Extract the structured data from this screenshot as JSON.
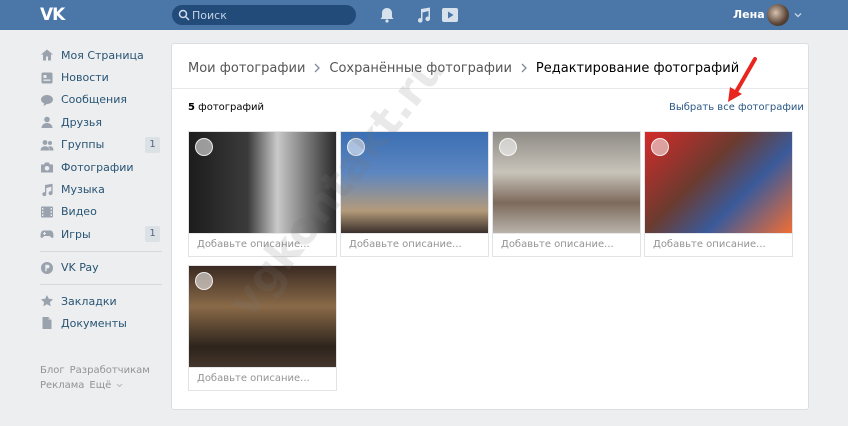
{
  "header": {
    "logo_text": "VK",
    "search_placeholder": "Поиск",
    "user_name": "Лена",
    "accent": "#4a76a8"
  },
  "sidebar": {
    "items": [
      {
        "label": "Моя Страница",
        "icon": "home-icon"
      },
      {
        "label": "Новости",
        "icon": "news-icon"
      },
      {
        "label": "Сообщения",
        "icon": "messages-icon"
      },
      {
        "label": "Друзья",
        "icon": "friends-icon"
      },
      {
        "label": "Группы",
        "icon": "groups-icon",
        "count": "1"
      },
      {
        "label": "Фотографии",
        "icon": "camera-icon"
      },
      {
        "label": "Музыка",
        "icon": "music-icon"
      },
      {
        "label": "Видео",
        "icon": "video-icon"
      },
      {
        "label": "Игры",
        "icon": "games-icon",
        "count": "1"
      }
    ],
    "vkpay": {
      "label": "VK Pay",
      "icon": "vkpay-icon"
    },
    "items2": [
      {
        "label": "Закладки",
        "icon": "bookmark-star-icon"
      },
      {
        "label": "Документы",
        "icon": "documents-icon"
      }
    ],
    "footer": {
      "blog": "Блог",
      "developers": "Разработчикам",
      "ads": "Реклама",
      "more": "Ещё"
    }
  },
  "main": {
    "breadcrumbs": [
      "Мои фотографии",
      "Сохранённые фотографии",
      "Редактирование фотографий"
    ],
    "photo_count_number": "5",
    "photo_count_word": "фотографий",
    "select_all": "Выбрать все фотографии",
    "photos": [
      {
        "description_placeholder": "Добавьте описание..."
      },
      {
        "description_placeholder": "Добавьте описание..."
      },
      {
        "description_placeholder": "Добавьте описание..."
      },
      {
        "description_placeholder": "Добавьте описание..."
      },
      {
        "description_placeholder": "Добавьте описание..."
      }
    ]
  },
  "watermark": "vgkontakt.ru"
}
